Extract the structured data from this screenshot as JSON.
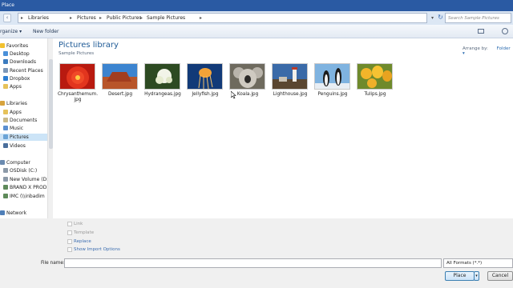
{
  "window": {
    "title": "Place"
  },
  "address": {
    "crumbs": [
      "Libraries",
      "Pictures",
      "Public Pictures",
      "Sample Pictures"
    ],
    "search_placeholder": "Search Sample Pictures"
  },
  "toolbar": {
    "organize": "rganize ▾",
    "new_folder": "New folder"
  },
  "nav": {
    "favorites": {
      "header": "Favorites",
      "items": [
        "Desktop",
        "Downloads",
        "Recent Places",
        "Dropbox",
        "Apps"
      ]
    },
    "libraries": {
      "header": "Libraries",
      "items": [
        "Apps",
        "Documents",
        "Music",
        "Pictures",
        "Videos"
      ]
    },
    "computer": {
      "header": "Computer",
      "items": [
        "OSDisk (C:)",
        "New Volume (D:",
        "BRAND X PROD",
        "IMC (\\\\inbadim"
      ]
    },
    "network": {
      "header": "Network"
    }
  },
  "content": {
    "title": "Pictures library",
    "subtitle": "Sample Pictures",
    "arrange_label": "Arrange by:",
    "arrange_value": "Folder ▾",
    "files": [
      {
        "name": "Chrysanthemum.jpg",
        "line1": "Chrysanthemum.",
        "line2": "jpg"
      },
      {
        "name": "Desert.jpg",
        "line1": "Desert.jpg",
        "line2": ""
      },
      {
        "name": "Hydrangeas.jpg",
        "line1": "Hydrangeas.jpg",
        "line2": ""
      },
      {
        "name": "Jellyfish.jpg",
        "line1": "Jellyfish.jpg",
        "line2": ""
      },
      {
        "name": "Koala.jpg",
        "line1": "Koala.jpg",
        "line2": ""
      },
      {
        "name": "Lighthouse.jpg",
        "line1": "Lighthouse.jpg",
        "line2": ""
      },
      {
        "name": "Penguins.jpg",
        "line1": "Penguins.jpg",
        "line2": ""
      },
      {
        "name": "Tulips.jpg",
        "line1": "Tulips.jpg",
        "line2": ""
      }
    ]
  },
  "options": {
    "link": "Link",
    "template": "Template",
    "replace": "Replace",
    "show_import": "Show Import Options"
  },
  "footer": {
    "file_name_label": "File name:",
    "file_name_value": "",
    "format": "All Formats (*.*)",
    "place": "Place",
    "cancel": "Cancel"
  }
}
